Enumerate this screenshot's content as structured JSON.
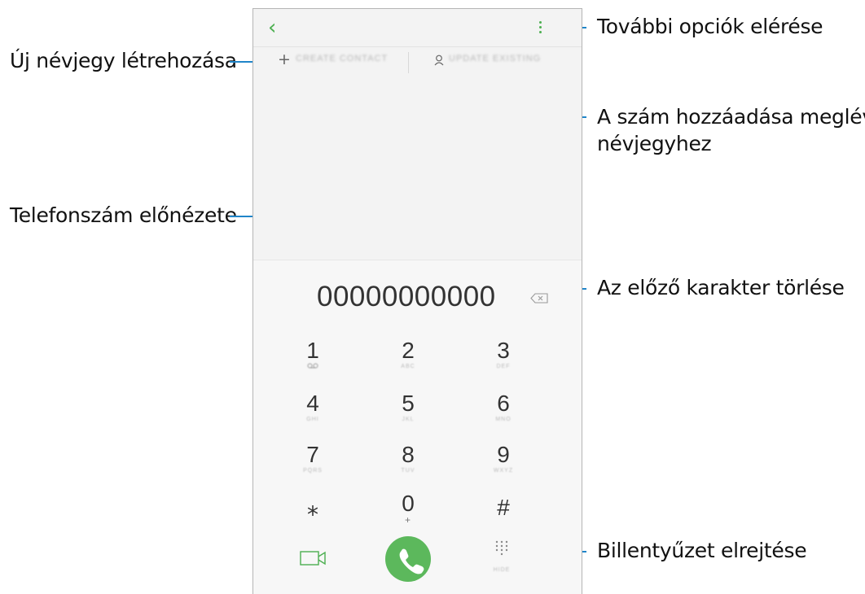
{
  "callouts": {
    "more_options": "További opciók elérése",
    "create_contact": "Új névjegy létrehozása",
    "add_to_existing_line1": "A szám hozzáadása meglévő",
    "add_to_existing_line2": "névjegyhez",
    "number_preview": "Telefonszám előnézete",
    "delete_char": "Az előző karakter törlése",
    "hide_keypad": "Billentyűzet elrejtése"
  },
  "phone": {
    "create_contact_label": "CREATE CONTACT",
    "update_existing_label": "UPDATE EXISTING",
    "number": "00000000000",
    "keys": [
      {
        "digit": "1",
        "sub": "∞"
      },
      {
        "digit": "2",
        "sub": "ABC"
      },
      {
        "digit": "3",
        "sub": "DEF"
      },
      {
        "digit": "4",
        "sub": "GHI"
      },
      {
        "digit": "5",
        "sub": "JKL"
      },
      {
        "digit": "6",
        "sub": "MNO"
      },
      {
        "digit": "7",
        "sub": "PQRS"
      },
      {
        "digit": "8",
        "sub": "TUV"
      },
      {
        "digit": "9",
        "sub": "WXYZ"
      },
      {
        "digit": "⁎",
        "sub": ""
      },
      {
        "digit": "0",
        "sub": "+"
      },
      {
        "digit": "#",
        "sub": ""
      }
    ],
    "hide_label": "HIDE"
  },
  "colors": {
    "accent": "#4caf50",
    "call": "#5cb85c",
    "callout_line": "#1f85c9"
  }
}
